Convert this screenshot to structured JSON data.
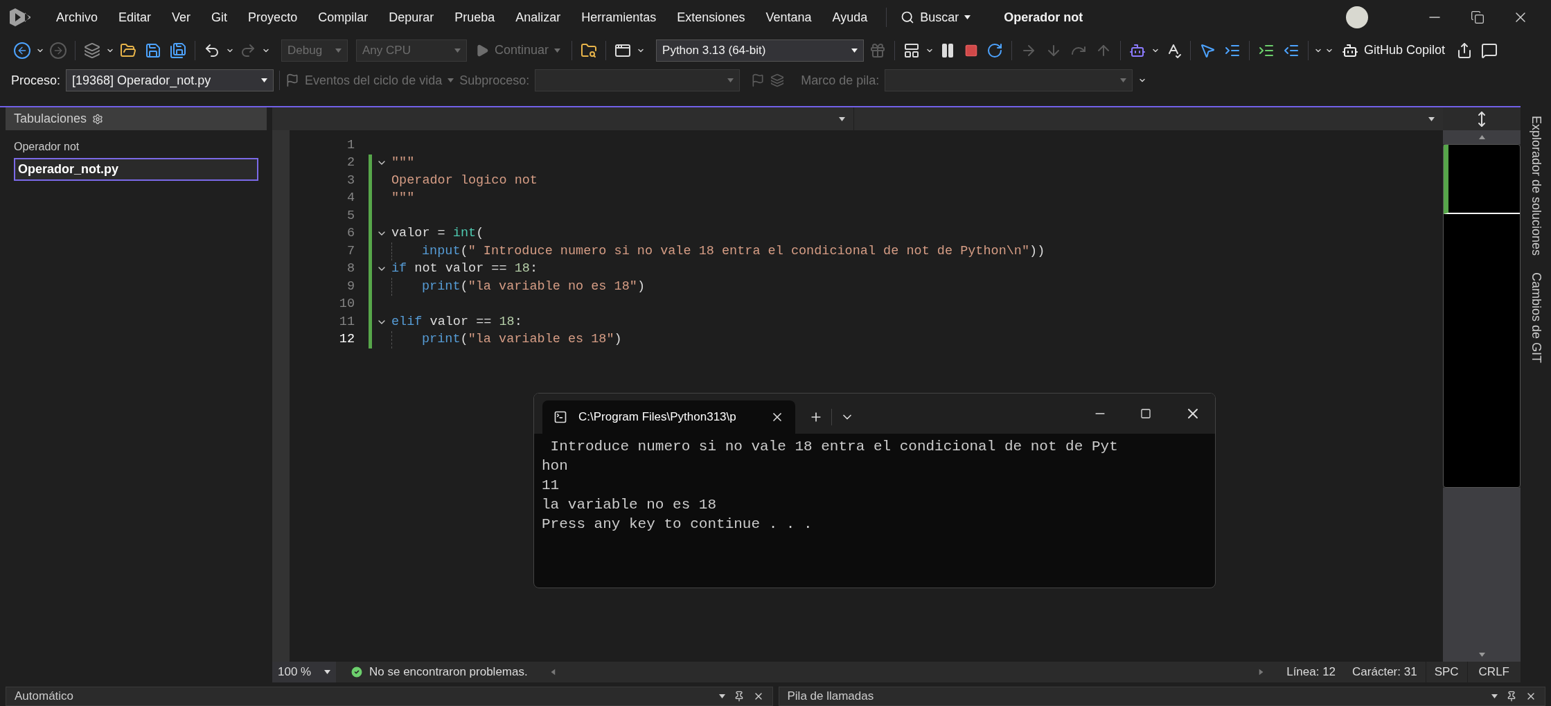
{
  "menu": [
    "Archivo",
    "Editar",
    "Ver",
    "Git",
    "Proyecto",
    "Compilar",
    "Depurar",
    "Prueba",
    "Analizar",
    "Herramientas",
    "Extensiones",
    "Ventana",
    "Ayuda"
  ],
  "search": {
    "label": "Buscar"
  },
  "window_title": "Operador not",
  "toolbar": {
    "configuration": {
      "value": "Debug",
      "disabled": true
    },
    "platform": {
      "value": "Any CPU",
      "disabled": true
    },
    "continue": {
      "label": "Continuar",
      "disabled": true
    },
    "interpreter": {
      "value": "Python 3.13 (64-bit)",
      "disabled": false
    },
    "copilot": "GitHub Copilot"
  },
  "debug_bar": {
    "process_label": "Proceso:",
    "process_value": "[19368] Operador_not.py",
    "lifecycle": "Eventos del ciclo de vida",
    "thread_label": "Subproceso:",
    "stack_label": "Marco de pila:"
  },
  "tabs_panel": {
    "title": "Tabulaciones",
    "group": "Operador not",
    "items": [
      {
        "label": "Operador_not.py",
        "selected": true
      }
    ]
  },
  "editor": {
    "lines": [
      {
        "number": "1",
        "current": false,
        "foldable": false,
        "changed": false,
        "indent": false
      },
      {
        "number": "2",
        "current": false,
        "foldable": true,
        "changed": true,
        "indent": false,
        "tokens": [
          {
            "t": "\"\"\"",
            "kind": "string"
          }
        ]
      },
      {
        "number": "3",
        "current": false,
        "foldable": false,
        "changed": true,
        "indent": false,
        "tokens": [
          {
            "t": "Operador logico not",
            "kind": "string"
          }
        ]
      },
      {
        "number": "4",
        "current": false,
        "foldable": false,
        "changed": true,
        "indent": false,
        "tokens": [
          {
            "t": "\"\"\"",
            "kind": "string"
          }
        ]
      },
      {
        "number": "5",
        "current": false,
        "foldable": false,
        "changed": true,
        "indent": false
      },
      {
        "number": "6",
        "current": false,
        "foldable": true,
        "changed": true,
        "indent": false,
        "tokens": [
          {
            "t": "valor = ",
            "kind": "plain"
          },
          {
            "t": "int",
            "kind": "builtin"
          },
          {
            "t": "(",
            "kind": "plain"
          }
        ]
      },
      {
        "number": "7",
        "current": false,
        "foldable": false,
        "changed": true,
        "indent": true,
        "tokens": [
          {
            "t": "input",
            "kind": "function"
          },
          {
            "t": "(",
            "kind": "plain"
          },
          {
            "t": "\" Introduce numero si no vale 18 entra el condicional de not de Python\\n\"",
            "kind": "string"
          },
          {
            "t": "))",
            "kind": "plain"
          }
        ]
      },
      {
        "number": "8",
        "current": false,
        "foldable": true,
        "changed": true,
        "indent": false,
        "tokens": [
          {
            "t": "if",
            "kind": "keyword"
          },
          {
            "t": " not valor == ",
            "kind": "plain"
          },
          {
            "t": "18",
            "kind": "number"
          },
          {
            "t": ":",
            "kind": "plain"
          }
        ]
      },
      {
        "number": "9",
        "current": false,
        "foldable": false,
        "changed": true,
        "indent": true,
        "tokens": [
          {
            "t": "print",
            "kind": "function"
          },
          {
            "t": "(",
            "kind": "plain"
          },
          {
            "t": "\"la variable no es 18\"",
            "kind": "string"
          },
          {
            "t": ")",
            "kind": "plain"
          }
        ]
      },
      {
        "number": "10",
        "current": false,
        "foldable": false,
        "changed": true,
        "indent": false
      },
      {
        "number": "11",
        "current": false,
        "foldable": true,
        "changed": true,
        "indent": false,
        "tokens": [
          {
            "t": "elif",
            "kind": "keyword"
          },
          {
            "t": " valor == ",
            "kind": "plain"
          },
          {
            "t": "18",
            "kind": "number"
          },
          {
            "t": ":",
            "kind": "plain"
          }
        ]
      },
      {
        "number": "12",
        "current": true,
        "foldable": false,
        "changed": true,
        "indent": true,
        "tokens": [
          {
            "t": "print",
            "kind": "function"
          },
          {
            "t": "(",
            "kind": "plain"
          },
          {
            "t": "\"la variable es 18\"",
            "kind": "string"
          },
          {
            "t": ")",
            "kind": "plain"
          }
        ]
      }
    ]
  },
  "console": {
    "tab_title": "C:\\Program Files\\Python313\\p",
    "lines": [
      " Introduce numero si no vale 18 entra el condicional de not de Pyt",
      "hon",
      "11",
      "la variable no es 18",
      "Press any key to continue . . . "
    ]
  },
  "status": {
    "zoom": "100 %",
    "problems": "No se encontraron problemas.",
    "line": "Línea: 12",
    "column": "Carácter: 31",
    "whitespace": "SPC",
    "line_ending": "CRLF"
  },
  "side_tabs": [
    "Explorador de soluciones",
    "Cambios de GIT"
  ],
  "bottom_panels": [
    {
      "title": "Automático"
    },
    {
      "title": "Pila de llamadas"
    }
  ]
}
